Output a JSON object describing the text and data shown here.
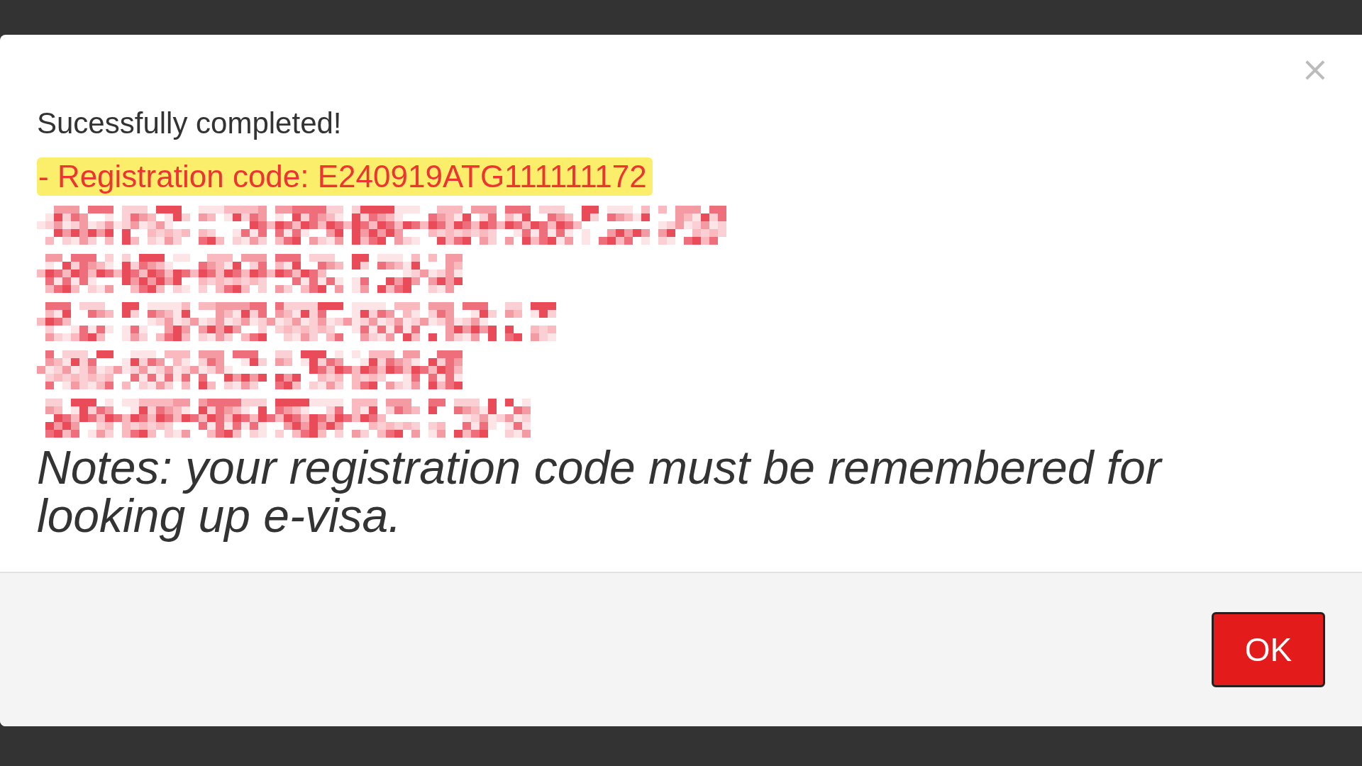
{
  "dialog": {
    "close": "×",
    "title": "Sucessfully completed!",
    "details": [
      {
        "kind": "text",
        "text": "- Registration code: E240919ATG111111172",
        "highlighted": true
      },
      {
        "kind": "redacted"
      },
      {
        "kind": "redacted"
      },
      {
        "kind": "redacted"
      },
      {
        "kind": "redacted"
      },
      {
        "kind": "redacted"
      }
    ],
    "note": "Notes: your registration code must be remembered for looking up e-visa.",
    "buttons": [
      "OK"
    ]
  }
}
